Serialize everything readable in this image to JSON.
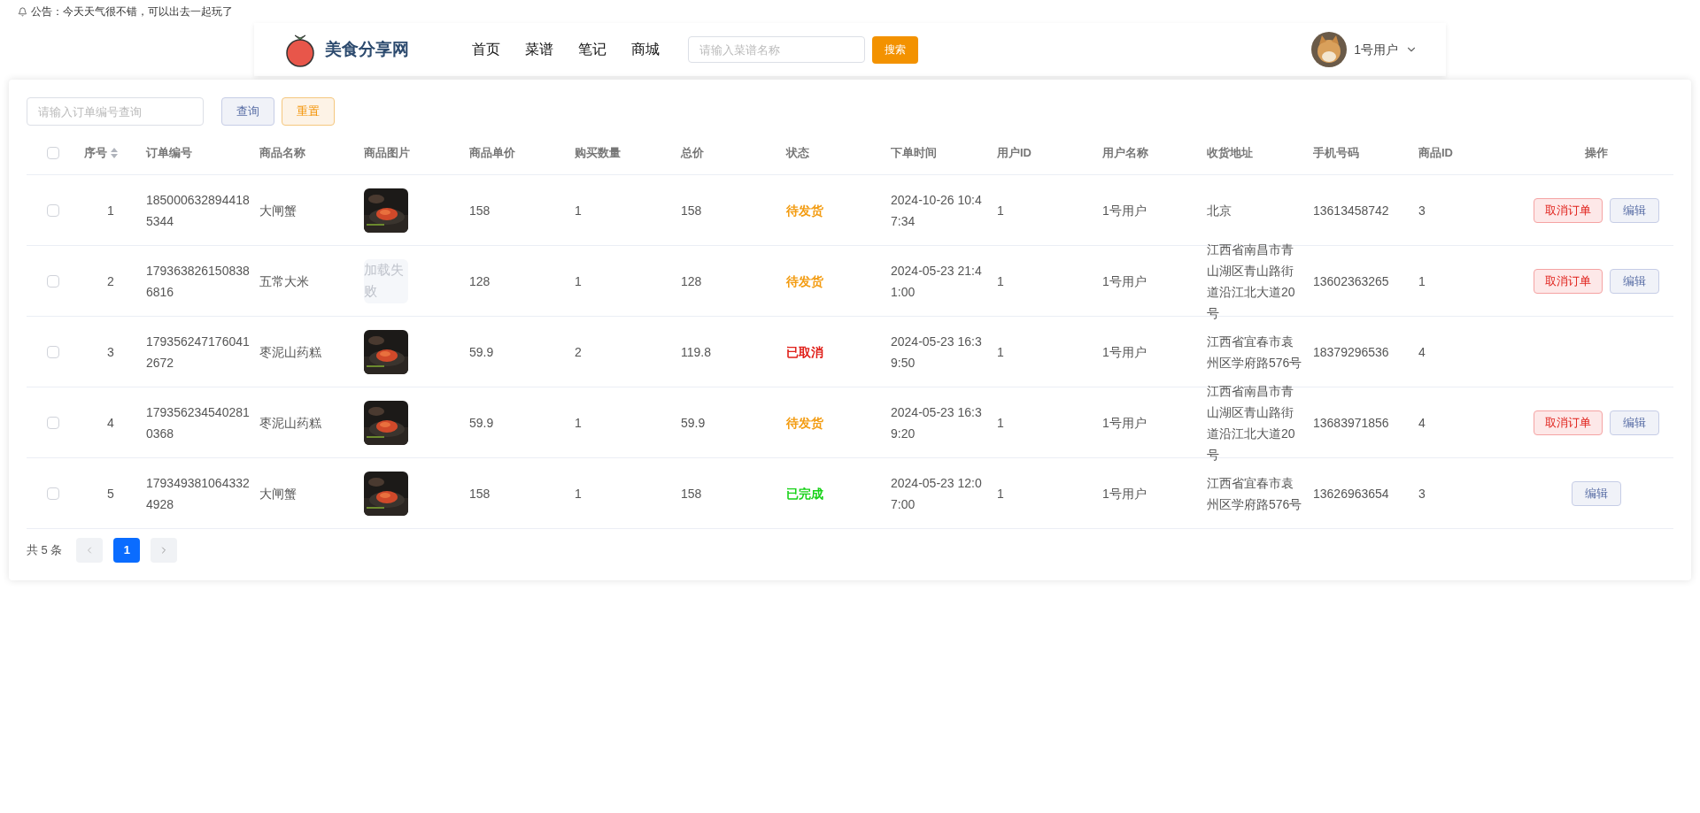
{
  "notice": {
    "text": "公告：今天天气很不错，可以出去一起玩了"
  },
  "header": {
    "site_name": "美食分享网",
    "nav": [
      {
        "label": "首页"
      },
      {
        "label": "菜谱"
      },
      {
        "label": "笔记"
      },
      {
        "label": "商城"
      }
    ],
    "search": {
      "placeholder": "请输入菜谱名称",
      "button": "搜索"
    },
    "user": {
      "name": "1号用户"
    }
  },
  "toolbar": {
    "search": {
      "placeholder": "请输入订单编号查询"
    },
    "query_button": "查询",
    "reset_button": "重置"
  },
  "table": {
    "select_all": {
      "checked": false
    },
    "columns": [
      "序号",
      "订单编号",
      "商品名称",
      "商品图片",
      "商品单价",
      "购买数量",
      "总价",
      "状态",
      "下单时间",
      "用户ID",
      "用户名称",
      "收货地址",
      "手机号码",
      "商品ID",
      "操作"
    ],
    "rows": [
      {
        "checked": false,
        "cells": [
          "1",
          "1850006328944185344",
          "大闸蟹"
        ],
        "image": {
          "kind": "picture"
        },
        "cells2": [
          "158",
          "1",
          "158"
        ],
        "status": {
          "text": "待发货",
          "color": "#f39c12"
        },
        "cells3": [
          "2024-10-26 10:47:34",
          "1",
          "1号用户",
          "北京",
          "13613458742",
          "3"
        ],
        "actions": [
          {
            "kind": "danger",
            "label": "取消订单"
          },
          {
            "kind": "default",
            "label": "编辑"
          }
        ]
      },
      {
        "checked": false,
        "cells": [
          "2",
          "1793638261508386816",
          "五常大米"
        ],
        "image": {
          "kind": "failed",
          "text": "加载失败"
        },
        "cells2": [
          "128",
          "1",
          "128"
        ],
        "status": {
          "text": "待发货",
          "color": "#f39c12"
        },
        "cells3": [
          "2024-05-23 21:41:00",
          "1",
          "1号用户",
          "江西省南昌市青山湖区青山路街道沿江北大道20号",
          "13602363265",
          "1"
        ],
        "actions": [
          {
            "kind": "danger",
            "label": "取消订单"
          },
          {
            "kind": "default",
            "label": "编辑"
          }
        ]
      },
      {
        "checked": false,
        "cells": [
          "3",
          "1793562471760412672",
          "枣泥山药糕"
        ],
        "image": {
          "kind": "picture"
        },
        "cells2": [
          "59.9",
          "2",
          "119.8"
        ],
        "status": {
          "text": "已取消",
          "color": "#e0201a"
        },
        "cells3": [
          "2024-05-23 16:39:50",
          "1",
          "1号用户",
          "江西省宜春市袁州区学府路576号",
          "18379296536",
          "4"
        ]
      },
      {
        "checked": false,
        "cells": [
          "4",
          "1793562345402810368",
          "枣泥山药糕"
        ],
        "image": {
          "kind": "picture"
        },
        "cells2": [
          "59.9",
          "1",
          "59.9"
        ],
        "status": {
          "text": "待发货",
          "color": "#f39c12"
        },
        "cells3": [
          "2024-05-23 16:39:20",
          "1",
          "1号用户",
          "江西省南昌市青山湖区青山路街道沿江北大道20号",
          "13683971856",
          "4"
        ],
        "actions": [
          {
            "kind": "danger",
            "label": "取消订单"
          },
          {
            "kind": "default",
            "label": "编辑"
          }
        ]
      },
      {
        "checked": false,
        "cells": [
          "5",
          "1793493810643324928",
          "大闸蟹"
        ],
        "image": {
          "kind": "picture"
        },
        "cells2": [
          "158",
          "1",
          "158"
        ],
        "status": {
          "text": "已完成",
          "color": "#19d219"
        },
        "cells3": [
          "2024-05-23 12:07:00",
          "1",
          "1号用户",
          "江西省宜春市袁州区学府路576号",
          "13626963654",
          "3"
        ],
        "actions": [
          {
            "kind": "default",
            "label": "编辑"
          }
        ]
      }
    ]
  },
  "pagination": {
    "total": "共 5 条",
    "pages": [
      {
        "label": "1",
        "selected": true
      }
    ]
  }
}
